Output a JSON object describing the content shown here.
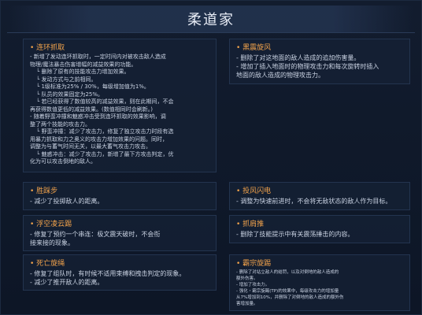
{
  "header": {
    "title": "柔道家"
  },
  "sections": {
    "s1": {
      "title": "连环抓取",
      "lines": [
        "- 新增了发动连环抓取时，一定时间内对被攻击敌人造成",
        "物理/魔法暴击伤害增幅的减益效果的功能。",
        "└ 删除了原有的技能攻击力增加效果。",
        "└ 发动方式与之前相同。",
        "└ 1级标准为25% / 30%，每级增加值为1%。",
        "└ 队员的效果固定为25%。",
        "└ 若已经获得了数值较高的减益效果，则在此期间，不会",
        "再获得数值更低的减益效果。(数值相同时会刷新。)",
        "- 随着野蛮冲撞和魅惑冲击受到连环抓取的效果影响，调",
        "整了两个技能的攻击力。",
        "└ 野蛮冲撞：减少了攻击力，修复了独立攻击力时段有选",
        "用暴力抓取和力之奥义的攻击力增加效果的问题。同时，",
        "调整为与蓄气时间无关，以最大蓄气攻击力攻击。",
        "└ 魅惑冲击：减少了攻击力，新增了最下方攻击判定，优",
        "化为可以攻击倒地的敌人。"
      ]
    },
    "s2": {
      "title": "黑震旋风",
      "lines": [
        "- 删除了对这地面的敌人造成的追加伤害量。",
        "- 增加了插入地面时的物理攻击力和每次旋转时插入",
        "地面的敌人造成的物理攻击力。"
      ]
    },
    "s3": {
      "title": "胜踩步",
      "lines": [
        "- 减少了投掷敌人的距离。"
      ]
    },
    "s4": {
      "title": "投风闪电",
      "lines": [
        "- 调整为快速前进时，不会将无敌状态的敌人作为目标。"
      ]
    },
    "s5": {
      "title": "浮空凌云踢",
      "lines": [
        "- 修复了预约一个串连：极文震天破时，不会衔",
        "接来接的现象。"
      ]
    },
    "s6": {
      "title": "抓肩推",
      "lines": [
        "- 删除了技能提示中有关震荡捶击的内容。"
      ]
    },
    "s7": {
      "title": "死亡旋绳",
      "lines": [
        "- 修复了组队时，有时候不适用束缚和拽击判定的现象。",
        "- 减少了推开敌人的距离。"
      ]
    },
    "s8": {
      "title": "霸宗旋踢",
      "lines": [
        "- 删除了对站立敌人的结罚，以及对倒地的敌人造成的",
        "额外伤害。",
        "- 增加了攻击力。",
        "- 强化・霸宗旋踢(TP)的效果中，每级攻击力的增加量",
        "从7%增加到10%，并删除了对倒地的敌人造成的额外伤",
        "害增加量。"
      ]
    }
  }
}
